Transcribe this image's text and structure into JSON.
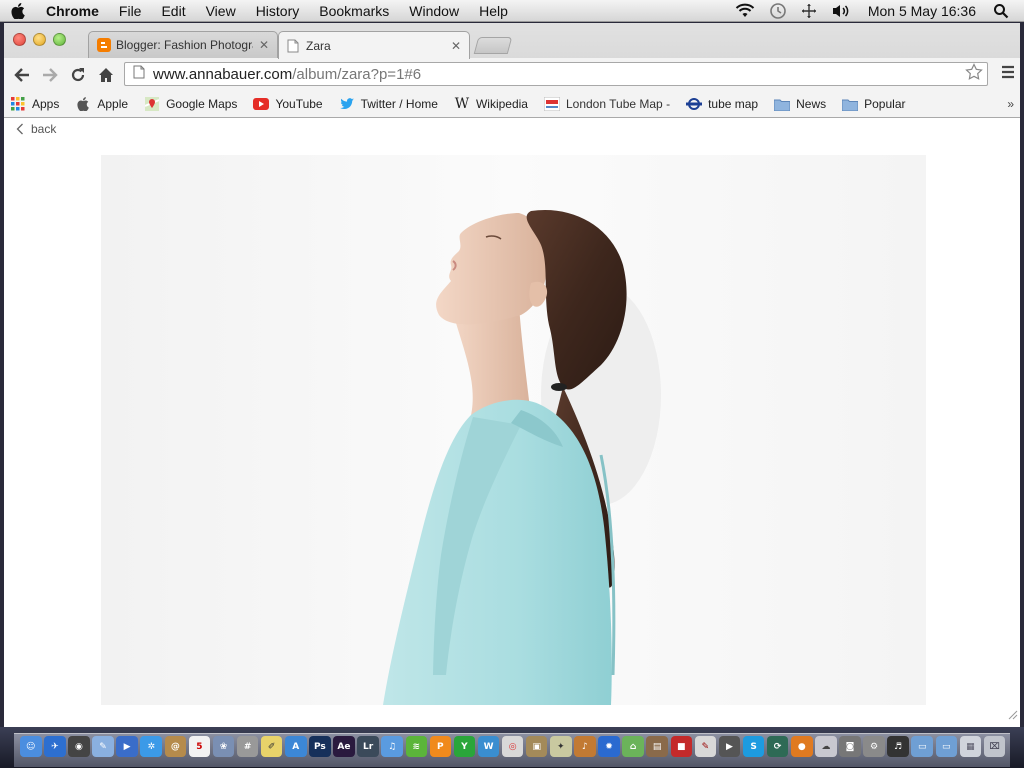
{
  "menubar": {
    "app_name": "Chrome",
    "menus": [
      "File",
      "Edit",
      "View",
      "History",
      "Bookmarks",
      "Window",
      "Help"
    ],
    "clock": "Mon 5 May  16:36",
    "status_icons": [
      "wifi-icon",
      "time-machine-icon",
      "move-icon",
      "volume-icon"
    ]
  },
  "tabs": [
    {
      "title": "Blogger: Fashion Photography",
      "icon": "blogger-icon",
      "active": false
    },
    {
      "title": "Zara",
      "icon": "page-icon",
      "active": true
    }
  ],
  "address_bar": {
    "host": "www.annabauer.com",
    "path": "/album/zara?p=1#6"
  },
  "bookmarks": [
    {
      "label": "Apps",
      "icon": "apps-grid-icon"
    },
    {
      "label": "Apple",
      "icon": "apple-icon"
    },
    {
      "label": "Google Maps",
      "icon": "google-maps-icon"
    },
    {
      "label": "YouTube",
      "icon": "youtube-icon"
    },
    {
      "label": "Twitter / Home",
      "icon": "twitter-icon"
    },
    {
      "label": "Wikipedia",
      "icon": "wikipedia-icon"
    },
    {
      "label": "London Tube Map -",
      "icon": "tube-map-icon"
    },
    {
      "label": "tube map",
      "icon": "underground-roundel-icon"
    },
    {
      "label": "News",
      "icon": "folder-icon"
    },
    {
      "label": "Popular",
      "icon": "folder-icon"
    }
  ],
  "bookmarks_overflow": "»",
  "page": {
    "back_label": "back",
    "photo_subject": "woman-in-light-blue-coat-profile"
  },
  "colors": {
    "coat": "#a9dde0",
    "hair": "#4a2e22",
    "skin": "#e8c6b0",
    "photo_bg": "#f5f5f5"
  },
  "dock": {
    "apps": [
      {
        "name": "finder-icon",
        "color": "#4b8ee0",
        "glyph": "☺"
      },
      {
        "name": "launchpad-icon",
        "color": "#2d6fd0",
        "glyph": "✈"
      },
      {
        "name": "dashboard-icon",
        "color": "#444",
        "glyph": "◉"
      },
      {
        "name": "preview-icon",
        "color": "#8ab0e0",
        "glyph": "✎"
      },
      {
        "name": "facetime-icon",
        "color": "#3a6dc9",
        "glyph": "▶"
      },
      {
        "name": "safari-icon",
        "color": "#3b9ae8",
        "glyph": "✲"
      },
      {
        "name": "contacts-icon",
        "color": "#b58b4c",
        "glyph": "@"
      },
      {
        "name": "calendar-icon",
        "color": "#f2f2f2",
        "glyph": "5",
        "text_color": "#c00"
      },
      {
        "name": "photos-icon",
        "color": "#7a8fb3",
        "glyph": "❀"
      },
      {
        "name": "calculator-icon",
        "color": "#999",
        "glyph": "#"
      },
      {
        "name": "stickies-icon",
        "color": "#e8d36a",
        "glyph": "✐",
        "text_color": "#333"
      },
      {
        "name": "app-store-icon",
        "color": "#3c87d6",
        "glyph": "A"
      },
      {
        "name": "photoshop-icon",
        "color": "#16305a",
        "glyph": "Ps"
      },
      {
        "name": "after-effects-icon",
        "color": "#2a1a3e",
        "glyph": "Ae"
      },
      {
        "name": "lightroom-icon",
        "color": "#3b4a5a",
        "glyph": "Lr"
      },
      {
        "name": "itunes-icon",
        "color": "#5a9be0",
        "glyph": "♫"
      },
      {
        "name": "spotify-icon",
        "color": "#5bb53a",
        "glyph": "≋"
      },
      {
        "name": "p-app-icon",
        "color": "#f08a1c",
        "glyph": "P"
      },
      {
        "name": "y-app-icon",
        "color": "#2aa63a",
        "glyph": "Y"
      },
      {
        "name": "w-app-icon",
        "color": "#3a8ed0",
        "glyph": "W"
      },
      {
        "name": "chrome-icon",
        "color": "#d8d8d8",
        "glyph": "◎",
        "text_color": "#d33"
      },
      {
        "name": "image-capture-icon",
        "color": "#a38a5a",
        "glyph": "▣"
      },
      {
        "name": "bird-app-icon",
        "color": "#c9c9a0",
        "glyph": "✦",
        "text_color": "#333"
      },
      {
        "name": "guitar-icon",
        "color": "#c27a33",
        "glyph": "♪"
      },
      {
        "name": "sync-icon",
        "color": "#2a6ad0",
        "glyph": "✹"
      },
      {
        "name": "maps-icon",
        "color": "#6bb35a",
        "glyph": "⌂"
      },
      {
        "name": "photo-booth-icon",
        "color": "#8a6a4a",
        "glyph": "▤"
      },
      {
        "name": "record-icon",
        "color": "#c42a2a",
        "glyph": "■"
      },
      {
        "name": "acrobat-icon",
        "color": "#d8d8d8",
        "glyph": "✎",
        "text_color": "#900"
      },
      {
        "name": "facetime-camera-icon",
        "color": "#555",
        "glyph": "▶"
      },
      {
        "name": "skype-icon",
        "color": "#1d9be0",
        "glyph": "S"
      },
      {
        "name": "time-machine-dock-icon",
        "color": "#2e6a55",
        "glyph": "⟳"
      },
      {
        "name": "firefox-icon",
        "color": "#e07a20",
        "glyph": "●"
      },
      {
        "name": "cloud-app-icon",
        "color": "#c8c8d0",
        "glyph": "☁",
        "text_color": "#444"
      },
      {
        "name": "camera-icon",
        "color": "#777",
        "glyph": "◙"
      },
      {
        "name": "system-preferences-icon",
        "color": "#8a8a8a",
        "glyph": "⚙"
      },
      {
        "name": "itunes-alt-icon",
        "color": "#333",
        "glyph": "♬"
      },
      {
        "name": "applications-folder-icon",
        "color": "#6f9fd4",
        "glyph": "▭"
      },
      {
        "name": "documents-folder-icon",
        "color": "#6f9fd4",
        "glyph": "▭"
      },
      {
        "name": "downloads-stack-icon",
        "color": "#d0d4dc",
        "glyph": "▦",
        "text_color": "#556"
      },
      {
        "name": "trash-icon",
        "color": "#c0c4cc",
        "glyph": "⌧",
        "text_color": "#445"
      }
    ]
  }
}
